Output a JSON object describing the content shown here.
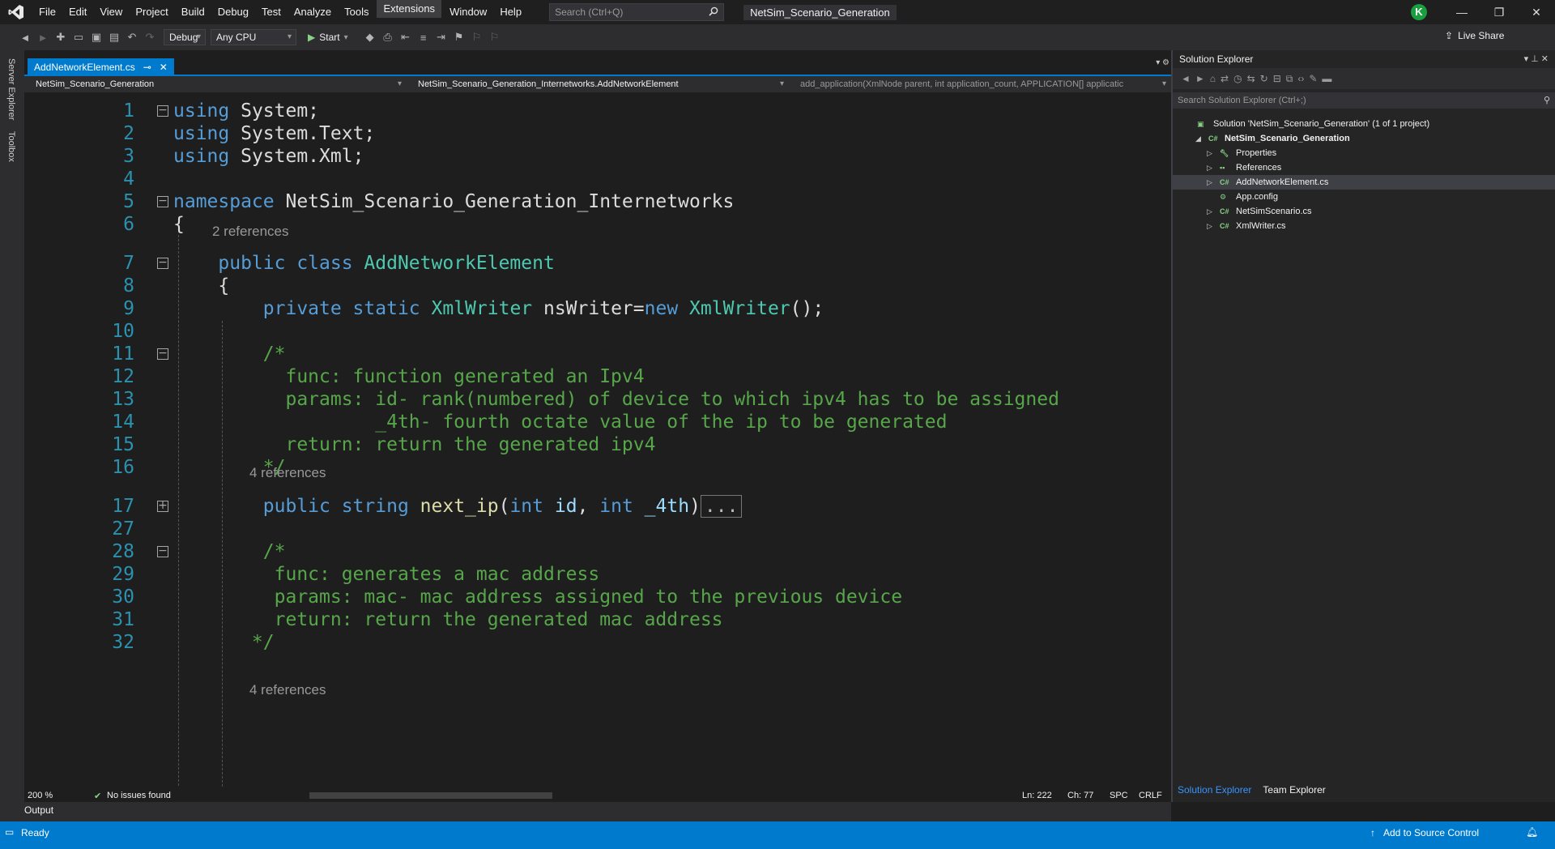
{
  "menu": [
    "File",
    "Edit",
    "View",
    "Project",
    "Build",
    "Debug",
    "Test",
    "Analyze",
    "Tools",
    "Extensions",
    "Window",
    "Help"
  ],
  "search": {
    "placeholder": "Search (Ctrl+Q)"
  },
  "solution_title": "NetSim_Scenario_Generation",
  "user_initial": "K",
  "toolbar": {
    "config": "Debug",
    "platform": "Any CPU",
    "start": "Start",
    "live_share": "Live Share"
  },
  "side_tabs": [
    "Server Explorer",
    "Toolbox"
  ],
  "document_tab": "AddNetworkElement.cs",
  "nav": {
    "project": "NetSim_Scenario_Generation",
    "type": "NetSim_Scenario_Generation_Internetworks.AddNetworkElement",
    "member": "add_application(XmlNode parent, int application_count, APPLICATION[] applicatic"
  },
  "code": {
    "codelens": [
      "2 references",
      "4 references",
      "4 references"
    ],
    "lines": [
      {
        "n": "1",
        "parts": [
          [
            "k",
            "using"
          ],
          [
            "p",
            " System;"
          ]
        ]
      },
      {
        "n": "2",
        "parts": [
          [
            "k",
            "using"
          ],
          [
            "p",
            " System.Text;"
          ]
        ]
      },
      {
        "n": "3",
        "parts": [
          [
            "k",
            "using"
          ],
          [
            "p",
            " System.Xml;"
          ]
        ]
      },
      {
        "n": "4",
        "parts": []
      },
      {
        "n": "5",
        "parts": [
          [
            "k",
            "namespace"
          ],
          [
            "p",
            " NetSim_Scenario_Generation_Internetworks"
          ]
        ]
      },
      {
        "n": "6",
        "parts": [
          [
            "p",
            "{"
          ]
        ]
      },
      {
        "n": "7",
        "parts": [
          [
            "p",
            "    "
          ],
          [
            "k",
            "public class"
          ],
          [
            "p",
            " "
          ],
          [
            "t",
            "AddNetworkElement"
          ]
        ]
      },
      {
        "n": "8",
        "parts": [
          [
            "p",
            "    {"
          ]
        ]
      },
      {
        "n": "9",
        "parts": [
          [
            "p",
            "        "
          ],
          [
            "k",
            "private static"
          ],
          [
            "p",
            " "
          ],
          [
            "t",
            "XmlWriter"
          ],
          [
            "p",
            " nsWriter="
          ],
          [
            "k",
            "new"
          ],
          [
            "p",
            " "
          ],
          [
            "t",
            "XmlWriter"
          ],
          [
            "p",
            "();"
          ]
        ]
      },
      {
        "n": "10",
        "parts": []
      },
      {
        "n": "11",
        "parts": [
          [
            "c",
            "        /*"
          ]
        ]
      },
      {
        "n": "12",
        "parts": [
          [
            "c",
            "          func: function generated an Ipv4"
          ]
        ]
      },
      {
        "n": "13",
        "parts": [
          [
            "c",
            "          params: id- rank(numbered) of device to which ipv4 has to be assigned"
          ]
        ]
      },
      {
        "n": "14",
        "parts": [
          [
            "c",
            "                  _4th- fourth octate value of the ip to be generated"
          ]
        ]
      },
      {
        "n": "15",
        "parts": [
          [
            "c",
            "          return: return the generated ipv4"
          ]
        ]
      },
      {
        "n": "16",
        "parts": [
          [
            "c",
            "        */"
          ]
        ]
      },
      {
        "n": "17",
        "parts": [
          [
            "p",
            "        "
          ],
          [
            "k",
            "public string"
          ],
          [
            "p",
            " "
          ],
          [
            "m",
            "next_ip"
          ],
          [
            "p",
            "("
          ],
          [
            "k",
            "int"
          ],
          [
            "p",
            " "
          ],
          [
            "v",
            "id"
          ],
          [
            "p",
            ", "
          ],
          [
            "k",
            "int"
          ],
          [
            "p",
            " "
          ],
          [
            "v",
            "_4th"
          ],
          [
            "p",
            ")"
          ],
          [
            "x",
            "..."
          ]
        ]
      },
      {
        "n": "27",
        "parts": []
      },
      {
        "n": "28",
        "parts": [
          [
            "c",
            "        /*"
          ]
        ]
      },
      {
        "n": "29",
        "parts": [
          [
            "c",
            "         func: generates a mac address"
          ]
        ]
      },
      {
        "n": "30",
        "parts": [
          [
            "c",
            "         params: mac- mac address assigned to the previous device"
          ]
        ]
      },
      {
        "n": "31",
        "parts": [
          [
            "c",
            "         return: return the generated mac address"
          ]
        ]
      },
      {
        "n": "32",
        "parts": [
          [
            "c",
            "       */"
          ]
        ]
      }
    ]
  },
  "editor_status": {
    "zoom": "200 %",
    "issues": "No issues found",
    "ln": "Ln: 222",
    "ch": "Ch: 77",
    "spc": "SPC",
    "crlf": "CRLF"
  },
  "output_label": "Output",
  "solution_explorer": {
    "title": "Solution Explorer",
    "search_placeholder": "Search Solution Explorer (Ctrl+;)",
    "items": [
      {
        "label": "Solution 'NetSim_Scenario_Generation' (1 of 1 project)",
        "icon": "solution-icon",
        "arrow": "",
        "depth": 0
      },
      {
        "label": "NetSim_Scenario_Generation",
        "icon": "csproj-icon",
        "arrow": "expanded",
        "depth": 1
      },
      {
        "label": "Properties",
        "icon": "wrench-icon",
        "arrow": "collapsed",
        "depth": 2
      },
      {
        "label": "References",
        "icon": "references-icon",
        "arrow": "collapsed",
        "depth": 2
      },
      {
        "label": "AddNetworkElement.cs",
        "icon": "cs-file-icon",
        "arrow": "collapsed",
        "depth": 2,
        "selected": true
      },
      {
        "label": "App.config",
        "icon": "config-icon",
        "arrow": "",
        "depth": 2
      },
      {
        "label": "NetSimScenario.cs",
        "icon": "cs-file-icon",
        "arrow": "collapsed",
        "depth": 2
      },
      {
        "label": "XmlWriter.cs",
        "icon": "cs-file-icon",
        "arrow": "collapsed",
        "depth": 2
      }
    ],
    "tabs": [
      "Solution Explorer",
      "Team Explorer"
    ]
  },
  "status": {
    "ready": "Ready",
    "source_control": "Add to Source Control"
  },
  "colors": {
    "accent": "#007acc",
    "keyword": "#569cd6",
    "type": "#4ec9b0",
    "comment": "#57a64a",
    "method": "#dcdcaa",
    "param": "#9cdcfe",
    "line_number": "#2b91af"
  }
}
